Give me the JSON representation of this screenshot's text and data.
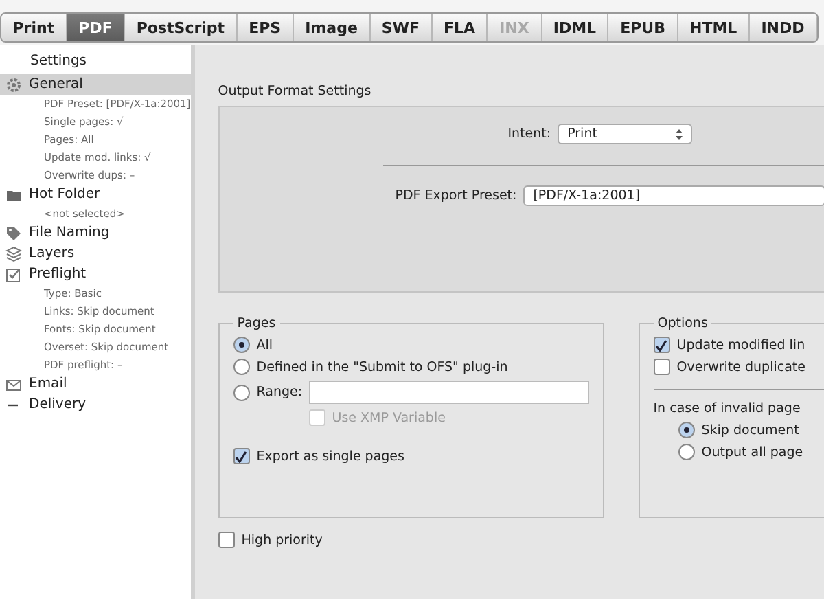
{
  "tabs": [
    {
      "label": "Print",
      "selected": false,
      "disabled": false
    },
    {
      "label": "PDF",
      "selected": true,
      "disabled": false
    },
    {
      "label": "PostScript",
      "selected": false,
      "disabled": false
    },
    {
      "label": "EPS",
      "selected": false,
      "disabled": false
    },
    {
      "label": "Image",
      "selected": false,
      "disabled": false
    },
    {
      "label": "SWF",
      "selected": false,
      "disabled": false
    },
    {
      "label": "FLA",
      "selected": false,
      "disabled": false
    },
    {
      "label": "INX",
      "selected": false,
      "disabled": true
    },
    {
      "label": "IDML",
      "selected": false,
      "disabled": false
    },
    {
      "label": "EPUB",
      "selected": false,
      "disabled": false
    },
    {
      "label": "HTML",
      "selected": false,
      "disabled": false
    },
    {
      "label": "INDD",
      "selected": false,
      "disabled": false
    }
  ],
  "sidebar": {
    "header": "Settings",
    "items": [
      {
        "label": "General",
        "selected": true,
        "children": [
          "PDF Preset: [PDF/X-1a:2001]",
          "Single pages: √",
          "Pages: All",
          "Update mod. links: √",
          "Overwrite dups: –"
        ]
      },
      {
        "label": "Hot Folder",
        "selected": false,
        "children": [
          "<not selected>"
        ]
      },
      {
        "label": "File Naming",
        "selected": false
      },
      {
        "label": "Layers",
        "selected": false
      },
      {
        "label": "Preflight",
        "selected": false,
        "children": [
          "Type: Basic",
          "Links: Skip document",
          "Fonts: Skip document",
          "Overset: Skip document",
          "PDF preflight: –"
        ]
      },
      {
        "label": "Email",
        "selected": false
      },
      {
        "label": "Delivery",
        "selected": false
      }
    ]
  },
  "output": {
    "title": "Output Format Settings",
    "intent_label": "Intent:",
    "intent_value": "Print",
    "preset_label": "PDF Export Preset:",
    "preset_value": "[PDF/X-1a:2001]"
  },
  "pages": {
    "title": "Pages",
    "options": [
      {
        "label": "All",
        "selected": true
      },
      {
        "label": "Defined in the \"Submit to OFS\" plug-in",
        "selected": false
      },
      {
        "label": "Range:",
        "selected": false
      }
    ],
    "use_xmp": {
      "label": "Use XMP Variable",
      "checked": false,
      "disabled": true
    },
    "single_pages": {
      "label": "Export as single pages",
      "checked": true
    }
  },
  "options": {
    "title": "Options",
    "checks": [
      {
        "label": "Update modified lin",
        "checked": true
      },
      {
        "label": "Overwrite duplicate",
        "checked": false
      }
    ],
    "invalid_label": "In case of invalid page",
    "invalid_options": [
      {
        "label": "Skip document",
        "selected": true
      },
      {
        "label": "Output all page",
        "selected": false
      }
    ]
  },
  "high_priority": {
    "label": "High priority",
    "checked": false
  }
}
